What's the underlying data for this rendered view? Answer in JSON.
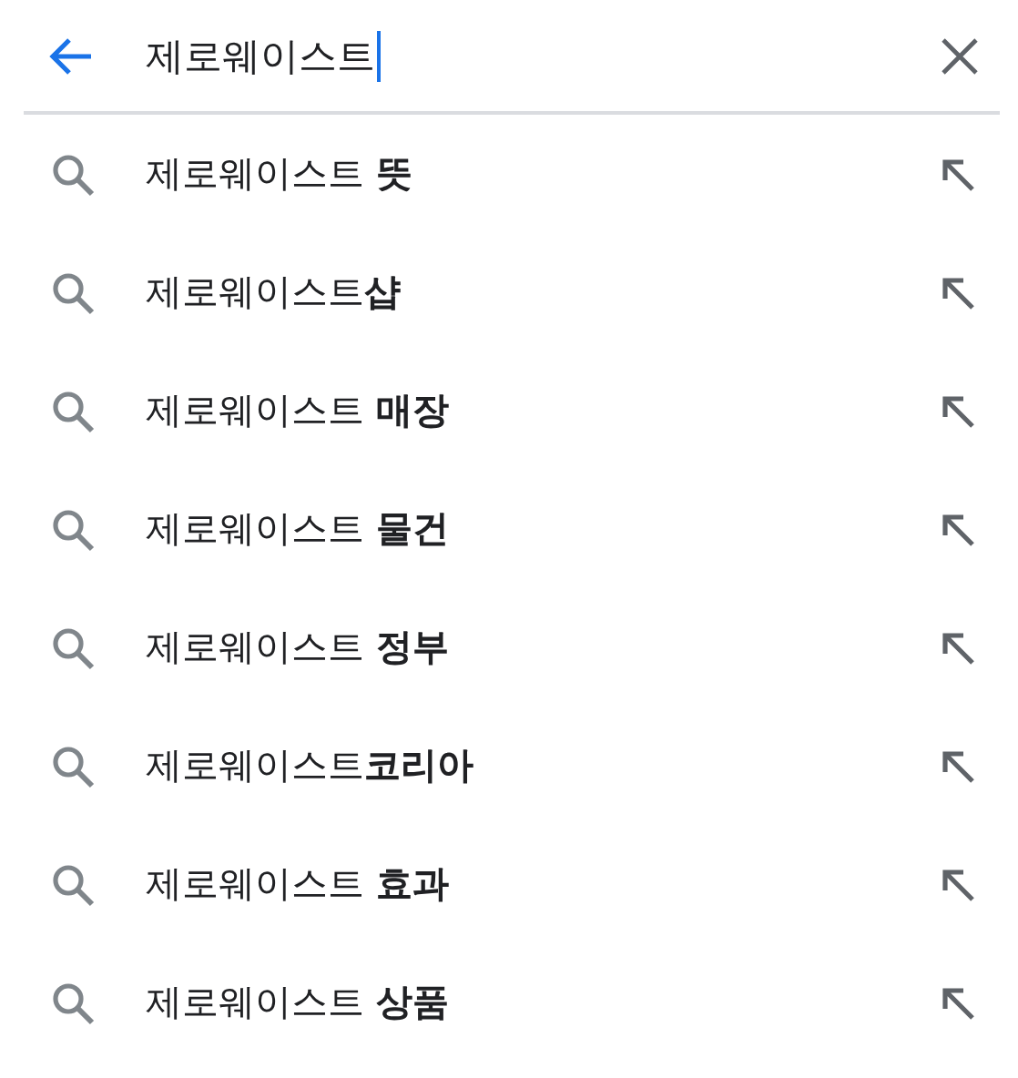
{
  "search": {
    "value": "제로웨이스트"
  },
  "suggestions": [
    {
      "text": "제로웨이스트 **뜻**"
    },
    {
      "text": "제로웨이스트**샵**"
    },
    {
      "text": "제로웨이스트 **매장**"
    },
    {
      "text": "제로웨이스트 **물건**"
    },
    {
      "text": "제로웨이스트 **정부**"
    },
    {
      "text": "제로웨이스트**코리아**"
    },
    {
      "text": "제로웨이스트 **효과**"
    },
    {
      "text": "제로웨이스트 **상품**"
    }
  ]
}
